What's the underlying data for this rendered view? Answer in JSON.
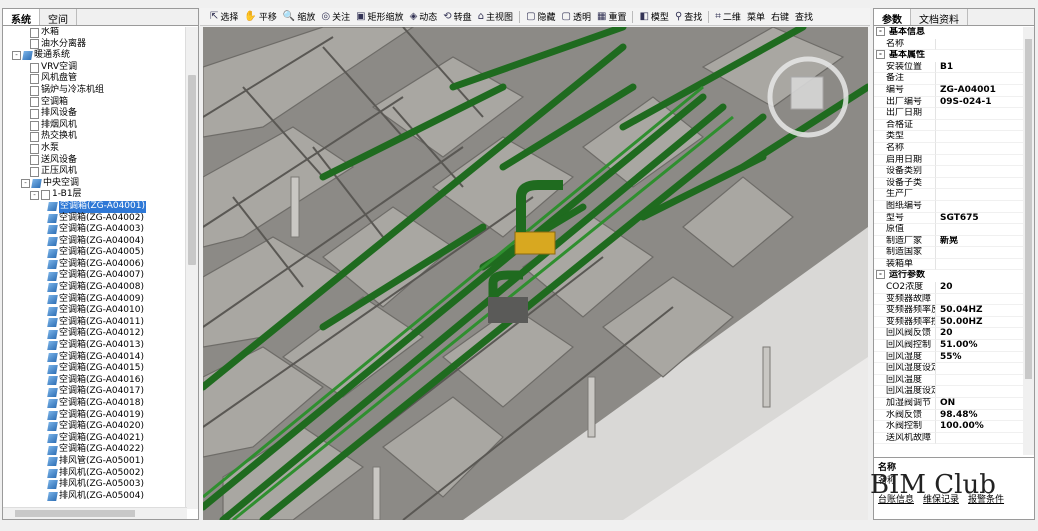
{
  "left_panel": {
    "tabs": [
      "系统",
      "空间"
    ],
    "tree": [
      {
        "indent": 3,
        "icon": "doc",
        "label": "水箱"
      },
      {
        "indent": 3,
        "icon": "doc",
        "label": "油水分离器"
      },
      {
        "indent": 1,
        "icon": "cube",
        "label": "暖通系统",
        "exp": "-"
      },
      {
        "indent": 3,
        "icon": "doc",
        "label": "VRV空调"
      },
      {
        "indent": 3,
        "icon": "doc",
        "label": "风机盘管"
      },
      {
        "indent": 3,
        "icon": "doc",
        "label": "锅炉与冷冻机组"
      },
      {
        "indent": 3,
        "icon": "doc",
        "label": "空调箱"
      },
      {
        "indent": 3,
        "icon": "doc",
        "label": "排风设备"
      },
      {
        "indent": 3,
        "icon": "doc",
        "label": "排烟风机"
      },
      {
        "indent": 3,
        "icon": "doc",
        "label": "热交换机"
      },
      {
        "indent": 3,
        "icon": "doc",
        "label": "水泵"
      },
      {
        "indent": 3,
        "icon": "doc",
        "label": "送风设备"
      },
      {
        "indent": 3,
        "icon": "doc",
        "label": "正压风机"
      },
      {
        "indent": 2,
        "icon": "cube",
        "label": "中央空调",
        "exp": "-"
      },
      {
        "indent": 3,
        "icon": "doc",
        "label": "1-B1层",
        "exp": "-"
      },
      {
        "indent": 5,
        "icon": "cube",
        "label": "空调箱(ZG-A04001)",
        "selected": true
      },
      {
        "indent": 5,
        "icon": "cube",
        "label": "空调箱(ZG-A04002)"
      },
      {
        "indent": 5,
        "icon": "cube",
        "label": "空调箱(ZG-A04003)"
      },
      {
        "indent": 5,
        "icon": "cube",
        "label": "空调箱(ZG-A04004)"
      },
      {
        "indent": 5,
        "icon": "cube",
        "label": "空调箱(ZG-A04005)"
      },
      {
        "indent": 5,
        "icon": "cube",
        "label": "空调箱(ZG-A04006)"
      },
      {
        "indent": 5,
        "icon": "cube",
        "label": "空调箱(ZG-A04007)"
      },
      {
        "indent": 5,
        "icon": "cube",
        "label": "空调箱(ZG-A04008)"
      },
      {
        "indent": 5,
        "icon": "cube",
        "label": "空调箱(ZG-A04009)"
      },
      {
        "indent": 5,
        "icon": "cube",
        "label": "空调箱(ZG-A04010)"
      },
      {
        "indent": 5,
        "icon": "cube",
        "label": "空调箱(ZG-A04011)"
      },
      {
        "indent": 5,
        "icon": "cube",
        "label": "空调箱(ZG-A04012)"
      },
      {
        "indent": 5,
        "icon": "cube",
        "label": "空调箱(ZG-A04013)"
      },
      {
        "indent": 5,
        "icon": "cube",
        "label": "空调箱(ZG-A04014)"
      },
      {
        "indent": 5,
        "icon": "cube",
        "label": "空调箱(ZG-A04015)"
      },
      {
        "indent": 5,
        "icon": "cube",
        "label": "空调箱(ZG-A04016)"
      },
      {
        "indent": 5,
        "icon": "cube",
        "label": "空调箱(ZG-A04017)"
      },
      {
        "indent": 5,
        "icon": "cube",
        "label": "空调箱(ZG-A04018)"
      },
      {
        "indent": 5,
        "icon": "cube",
        "label": "空调箱(ZG-A04019)"
      },
      {
        "indent": 5,
        "icon": "cube",
        "label": "空调箱(ZG-A04020)"
      },
      {
        "indent": 5,
        "icon": "cube",
        "label": "空调箱(ZG-A04021)"
      },
      {
        "indent": 5,
        "icon": "cube",
        "label": "空调箱(ZG-A04022)"
      },
      {
        "indent": 5,
        "icon": "cube",
        "label": "排风管(ZG-A05001)"
      },
      {
        "indent": 5,
        "icon": "cube",
        "label": "排风机(ZG-A05002)"
      },
      {
        "indent": 5,
        "icon": "cube",
        "label": "排风机(ZG-A05003)"
      },
      {
        "indent": 5,
        "icon": "cube",
        "label": "排风机(ZG-A05004)"
      }
    ]
  },
  "toolbar": [
    {
      "icon": "cursor-icon",
      "glyph": "⇱",
      "label": "选择"
    },
    {
      "icon": "pan-hand-icon",
      "glyph": "✋",
      "label": "平移"
    },
    {
      "icon": "zoom-icon",
      "glyph": "🔍",
      "label": "缩放"
    },
    {
      "icon": "focus-icon",
      "glyph": "◎",
      "label": "关注"
    },
    {
      "icon": "rect-zoom-icon",
      "glyph": "▣",
      "label": "矩形缩放"
    },
    {
      "icon": "dynamic-icon",
      "glyph": "◈",
      "label": "动态"
    },
    {
      "icon": "turntable-icon",
      "glyph": "⟲",
      "label": "转盘"
    },
    {
      "icon": "home-icon",
      "glyph": "⌂",
      "label": "主视图"
    },
    {
      "sep": true
    },
    {
      "icon": "hide-icon",
      "glyph": "▢",
      "label": "隐藏"
    },
    {
      "icon": "transparent-icon",
      "glyph": "▢",
      "label": "透明"
    },
    {
      "icon": "reset-icon",
      "glyph": "▦",
      "label": "重置"
    },
    {
      "sep": true
    },
    {
      "icon": "model-icon",
      "glyph": "◧",
      "label": "模型"
    },
    {
      "icon": "find-icon",
      "glyph": "⚲",
      "label": "查找"
    },
    {
      "sep": true
    },
    {
      "icon": "2d-icon",
      "glyph": "⌗",
      "label": "二维"
    },
    {
      "icon": "",
      "glyph": "",
      "label": "菜单"
    },
    {
      "icon": "",
      "glyph": "",
      "label": "右键"
    },
    {
      "icon": "",
      "glyph": "",
      "label": "查找"
    }
  ],
  "right_panel": {
    "tabs": [
      "参数",
      "文档资料"
    ],
    "properties": [
      {
        "cat": "基本信息"
      },
      {
        "k": "名称",
        "v": ""
      },
      {
        "cat": "基本属性"
      },
      {
        "k": "安装位置",
        "v": "B1"
      },
      {
        "k": "备注",
        "v": ""
      },
      {
        "k": "编号",
        "v": "ZG-A04001"
      },
      {
        "k": "出厂编号",
        "v": "09S-024-1"
      },
      {
        "k": "出厂日期",
        "v": ""
      },
      {
        "k": "合格证",
        "v": ""
      },
      {
        "k": "类型",
        "v": ""
      },
      {
        "k": "名称",
        "v": ""
      },
      {
        "k": "启用日期",
        "v": ""
      },
      {
        "k": "设备类别",
        "v": ""
      },
      {
        "k": "设备子类",
        "v": ""
      },
      {
        "k": "生产厂",
        "v": ""
      },
      {
        "k": "图纸编号",
        "v": ""
      },
      {
        "k": "型号",
        "v": "SGT675"
      },
      {
        "k": "原值",
        "v": ""
      },
      {
        "k": "制造厂家",
        "v": "新晃"
      },
      {
        "k": "制造国家",
        "v": ""
      },
      {
        "k": "装箱单",
        "v": ""
      },
      {
        "cat": "运行参数"
      },
      {
        "k": "CO2浓度",
        "v": "20"
      },
      {
        "k": "变频器故障",
        "v": ""
      },
      {
        "k": "变频器频率反馈",
        "v": "50.04HZ"
      },
      {
        "k": "变频器频率控制",
        "v": "50.00HZ"
      },
      {
        "k": "回风阀反馈",
        "v": "20"
      },
      {
        "k": "回风阀控制",
        "v": "51.00%"
      },
      {
        "k": "回风湿度",
        "v": "55%"
      },
      {
        "k": "回风湿度设定",
        "v": ""
      },
      {
        "k": "回风温度",
        "v": ""
      },
      {
        "k": "回风温度设定",
        "v": ""
      },
      {
        "k": "加湿阀调节",
        "v": "ON"
      },
      {
        "k": "水阀反馈",
        "v": "98.48%"
      },
      {
        "k": "水阀控制",
        "v": "100.00%"
      },
      {
        "k": "送风机故障",
        "v": ""
      }
    ],
    "desc_title": "名称",
    "desc_text": "名称",
    "links": [
      "台账信息",
      "维保记录",
      "报警条件"
    ]
  },
  "watermark": "BIM Club"
}
